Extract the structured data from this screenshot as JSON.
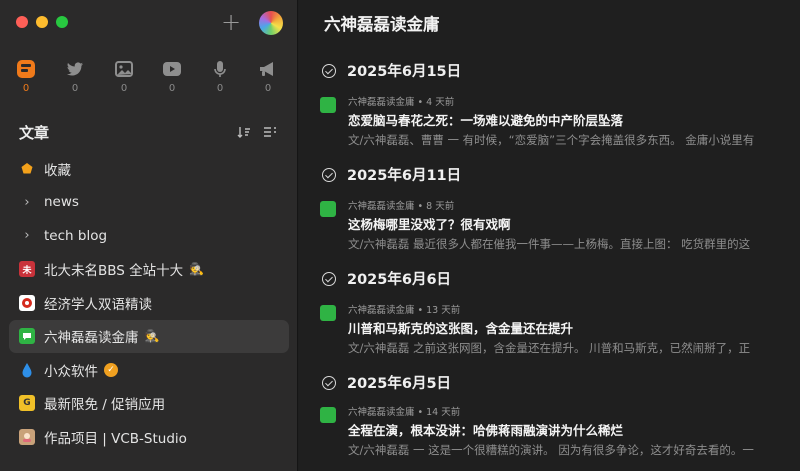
{
  "sidebar": {
    "feeds": [
      {
        "icon": "feed-app-icon",
        "count": "0"
      },
      {
        "icon": "twitter-icon",
        "count": "0"
      },
      {
        "icon": "image-icon",
        "count": "0"
      },
      {
        "icon": "video-icon",
        "count": "0"
      },
      {
        "icon": "microphone-icon",
        "count": "0"
      },
      {
        "icon": "megaphone-icon",
        "count": "0"
      }
    ],
    "section_title": "文章",
    "items": [
      {
        "label": "收藏",
        "icon": "star-icon"
      },
      {
        "label": "news",
        "icon": "chevron-right-icon"
      },
      {
        "label": "tech blog",
        "icon": "chevron-right-icon"
      },
      {
        "label": "北大未名BBS 全站十大",
        "icon": "bbs-icon",
        "suffix": "🕵"
      },
      {
        "label": "经济学人双语精读",
        "icon": "economist-icon"
      },
      {
        "label": "六神磊磊读金庸",
        "icon": "wechat-icon",
        "suffix": "🕵"
      },
      {
        "label": "小众软件",
        "icon": "drop-icon"
      },
      {
        "label": "最新限免 / 促销应用",
        "icon": "app-icon"
      },
      {
        "label": "作品项目 | VCB-Studio",
        "icon": "vcb-icon"
      }
    ]
  },
  "main": {
    "title": "六神磊磊读金庸",
    "groups": [
      {
        "date": "2025年6月15日",
        "article": {
          "meta": "六神磊磊读金庸 • 4 天前",
          "title": "恋爱脑马春花之死：一场难以避免的中产阶层坠落",
          "snippet": "文/六神磊磊、曹曹 一 有时候，“恋爱脑”三个字会掩盖很多东西。 金庸小说里有"
        }
      },
      {
        "date": "2025年6月11日",
        "article": {
          "meta": "六神磊磊读金庸 • 8 天前",
          "title": "这杨梅哪里没戏了？很有戏啊",
          "snippet": "文/六神磊磊 最近很多人都在催我一件事——上杨梅。直接上图： 吃货群里的这"
        }
      },
      {
        "date": "2025年6月6日",
        "article": {
          "meta": "六神磊磊读金庸 • 13 天前",
          "title": "川普和马斯克的这张图，含金量还在提升",
          "snippet": "文/六神磊磊 之前这张网图，含金量还在提升。 川普和马斯克，已然闹掰了，正"
        }
      },
      {
        "date": "2025年6月5日",
        "article": {
          "meta": "六神磊磊读金庸 • 14 天前",
          "title": "全程在演，根本没讲：哈佛蒋雨融演讲为什么稀烂",
          "snippet": "文/六神磊磊 一 这是一个很糟糕的演讲。 因为有很多争论，这才好奇去看的。一"
        }
      }
    ]
  }
}
